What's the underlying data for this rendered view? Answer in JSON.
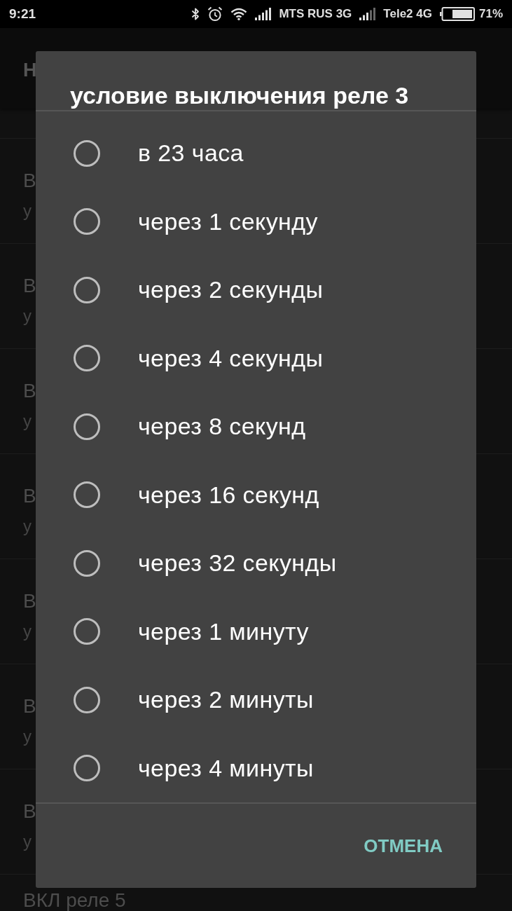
{
  "status_bar": {
    "time": "9:21",
    "carriers": [
      {
        "name": "MTS RUS 3G"
      },
      {
        "name": "Tele2 4G"
      }
    ],
    "battery": "71%"
  },
  "background": {
    "header_title": "Н",
    "rows": [
      {
        "title": "В",
        "subtitle": "у"
      },
      {
        "title": "В",
        "subtitle": "у"
      },
      {
        "title": "В",
        "subtitle": "у"
      },
      {
        "title": "В",
        "subtitle": "у"
      },
      {
        "title": "В",
        "subtitle": "у"
      },
      {
        "title": "В",
        "subtitle": "у"
      },
      {
        "title": "В",
        "subtitle": "у"
      }
    ],
    "partial_row_title": "ВКЛ реле 5"
  },
  "dialog": {
    "title": "условие выключения реле 3",
    "options": [
      {
        "label": "в 23 часа",
        "selected": false
      },
      {
        "label": "через 1 секунду",
        "selected": false
      },
      {
        "label": "через 2 секунды",
        "selected": false
      },
      {
        "label": "через 4 секунды",
        "selected": false
      },
      {
        "label": "через 8 секунд",
        "selected": false
      },
      {
        "label": "через 16 секунд",
        "selected": false
      },
      {
        "label": "через 32 секунды",
        "selected": false
      },
      {
        "label": "через 1 минуту",
        "selected": false
      },
      {
        "label": "через 2 минуты",
        "selected": false
      },
      {
        "label": "через 4 минуты",
        "selected": false
      }
    ],
    "buttons": [
      "ОТМЕНА"
    ]
  }
}
